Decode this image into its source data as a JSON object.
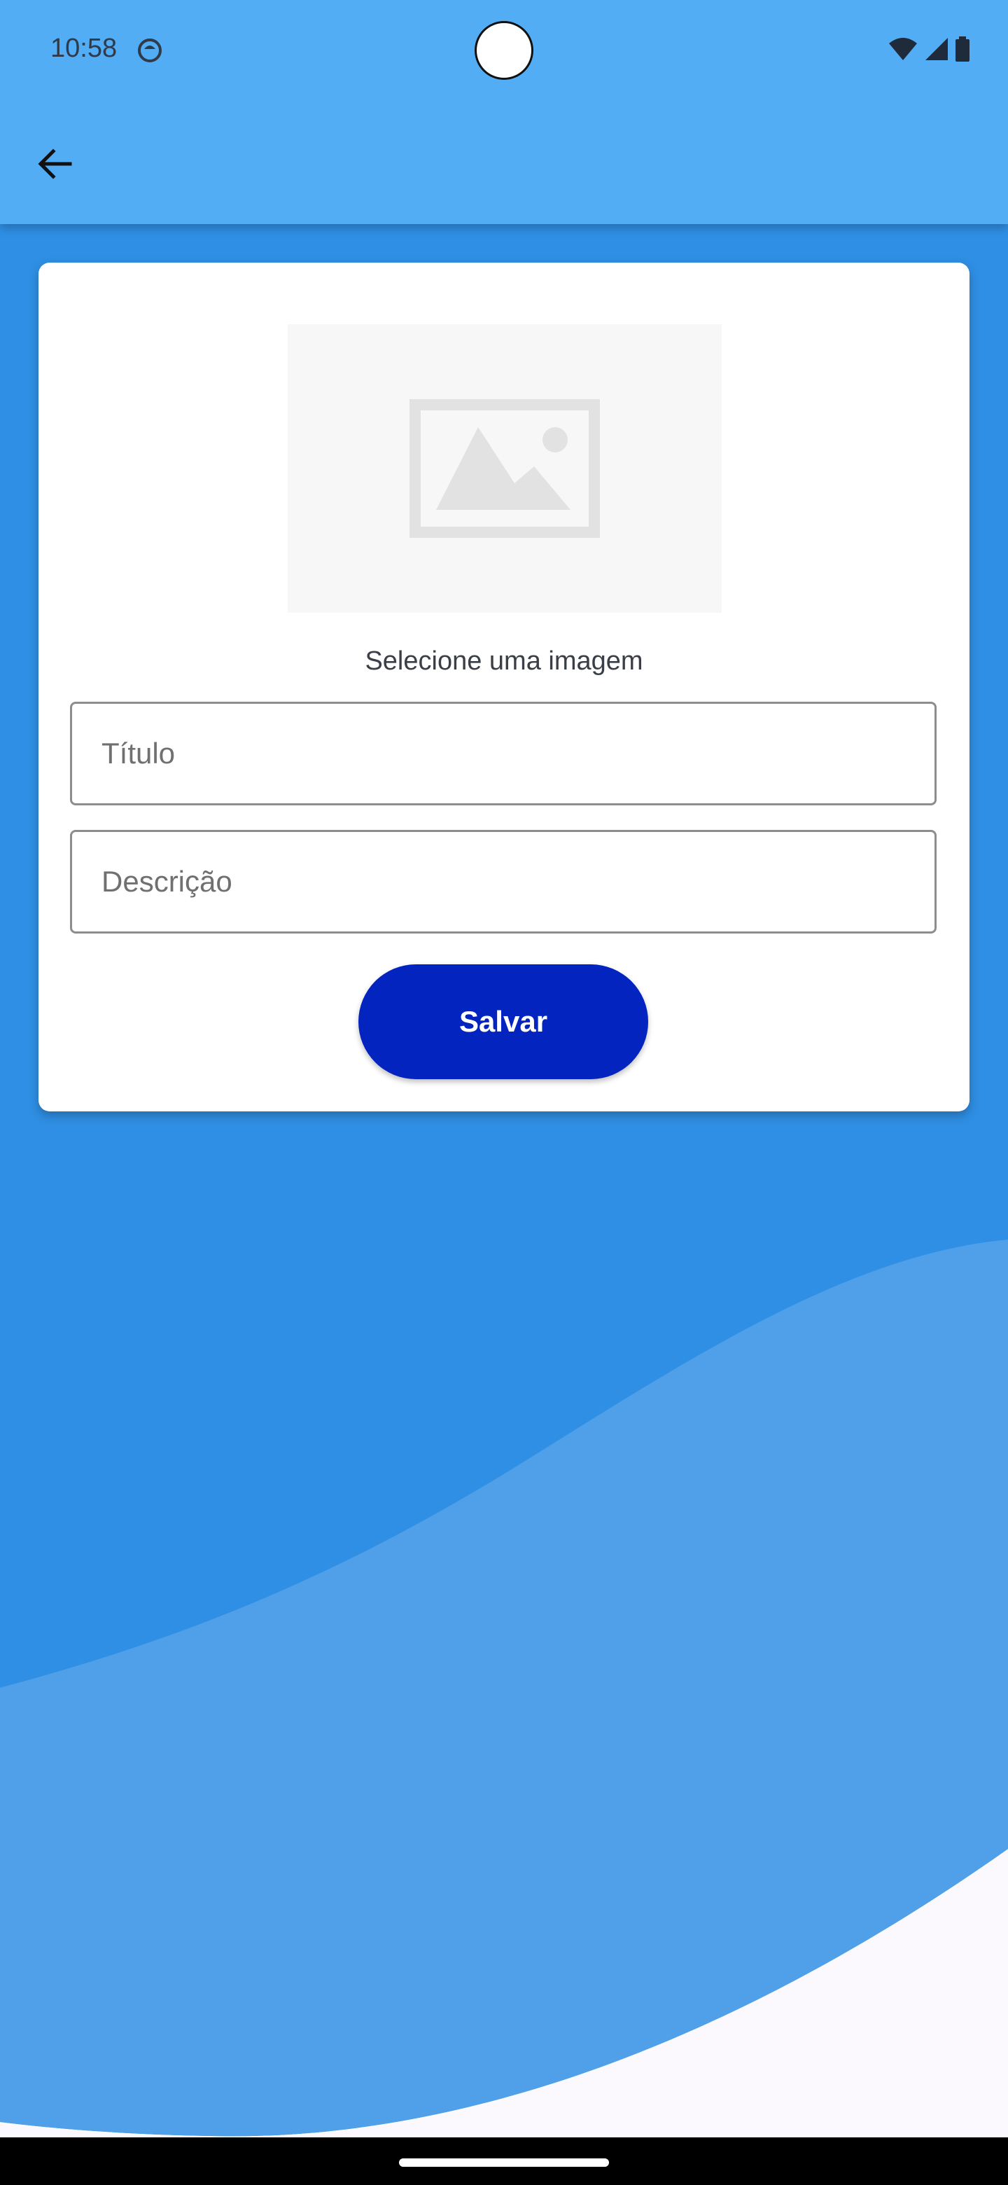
{
  "status_bar": {
    "time": "10:58",
    "icons": [
      "notification-app-icon",
      "wifi-icon",
      "signal-icon",
      "battery-icon"
    ]
  },
  "app_bar": {
    "back_icon": "arrow-back-icon",
    "color": "#53adf5"
  },
  "form": {
    "image_placeholder_icon": "image-placeholder-icon",
    "image_label": "Selecione uma imagem",
    "title_placeholder": "Título",
    "description_placeholder": "Descrição",
    "save_label": "Salvar"
  },
  "colors": {
    "background_blue": "#2f8fe4",
    "wave_light_blue": "#4fa0e8",
    "button": "#0324bf",
    "bottom_white": "#fbf9fd"
  }
}
